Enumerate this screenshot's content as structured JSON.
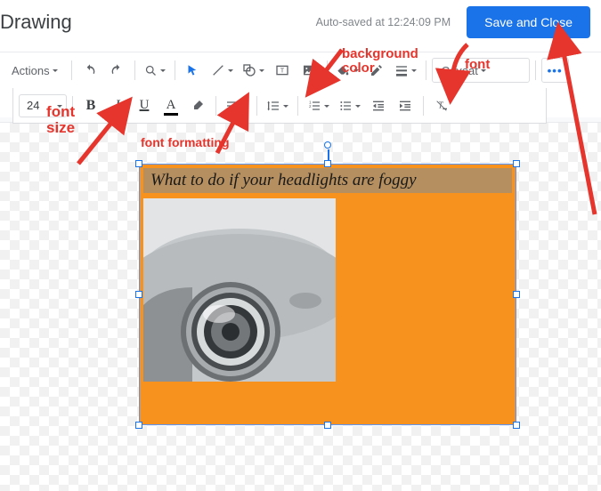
{
  "header": {
    "title": "Drawing",
    "autosave": "Auto-saved at 12:24:09 PM",
    "save_button": "Save and Close"
  },
  "toolbar1": {
    "actions": "Actions",
    "font_family": "Caveat",
    "more": "•••"
  },
  "toolbar2": {
    "font_size": "24",
    "bold": "B",
    "italic": "I",
    "underline": "U",
    "text_color_letter": "A"
  },
  "canvas": {
    "caption": "What to do if your headlights are foggy"
  },
  "annotations": {
    "bg_color": "background\ncolor",
    "font": "font",
    "font_size": "font\nsize",
    "font_formatting": "font formatting"
  }
}
